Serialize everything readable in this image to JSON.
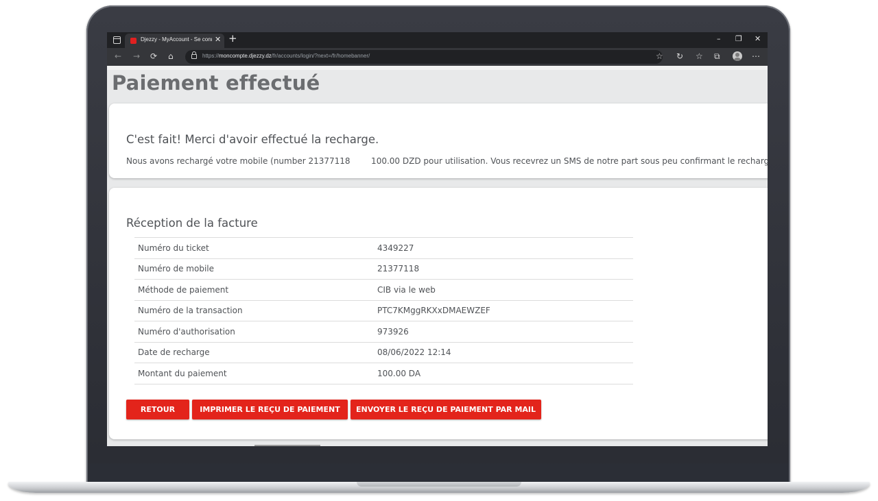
{
  "browser": {
    "tab_title": "Djezzy - MyAccount - Se connecter",
    "tab_close": "✕",
    "new_tab": "+",
    "window_controls": {
      "minimize": "–",
      "restore": "❐",
      "close": "✕"
    },
    "url_prefix": "https://",
    "url_host": "moncompte.djezzy.dz",
    "url_path": "/fr/accounts/login/?next=/fr/homebanner/",
    "nav": {
      "back": "←",
      "forward": "→",
      "reload": "⟳",
      "home": "⌂"
    },
    "toolbar_icons": [
      "favorites-add-icon",
      "refresh-shield-icon",
      "favorites-icon",
      "collections-icon",
      "profile-icon",
      "more-icon"
    ]
  },
  "page": {
    "title": "Paiement effectué",
    "confirmation": {
      "heading": "C'est fait! Merci d'avoir effectué la recharge.",
      "message": "Nous avons rechargé votre mobile (number 21377118        100.00 DZD pour utilisation. Vous recevrez un SMS de notre part sous peu confirmant le rechargement."
    },
    "invoice": {
      "heading": "Réception de la facture",
      "rows": [
        {
          "label": "Numéro du ticket",
          "value": "4349227"
        },
        {
          "label": "Numéro de mobile",
          "value": "21377118"
        },
        {
          "label": "Méthode de paiement",
          "value": "CIB via le web"
        },
        {
          "label": "Numéro de la transaction",
          "value": "PTC7KMggRKXxDMAEWZEF"
        },
        {
          "label": "Numéro d'authorisation",
          "value": "973926"
        },
        {
          "label": "Date de recharge",
          "value": "08/06/2022 12:14"
        },
        {
          "label": "Montant du paiement",
          "value": "100.00 DA"
        }
      ]
    },
    "buttons": {
      "back": "RETOUR",
      "print": "IMPRIMER LE REÇU DE PAIEMENT",
      "mail": "ENVOYER LE REÇU DE PAIEMENT PAR MAIL"
    }
  },
  "colors": {
    "accent": "#e3241b",
    "text": "#4f5256",
    "page_background": "#e8e9ea",
    "laptop_frame": "#2f3139"
  }
}
